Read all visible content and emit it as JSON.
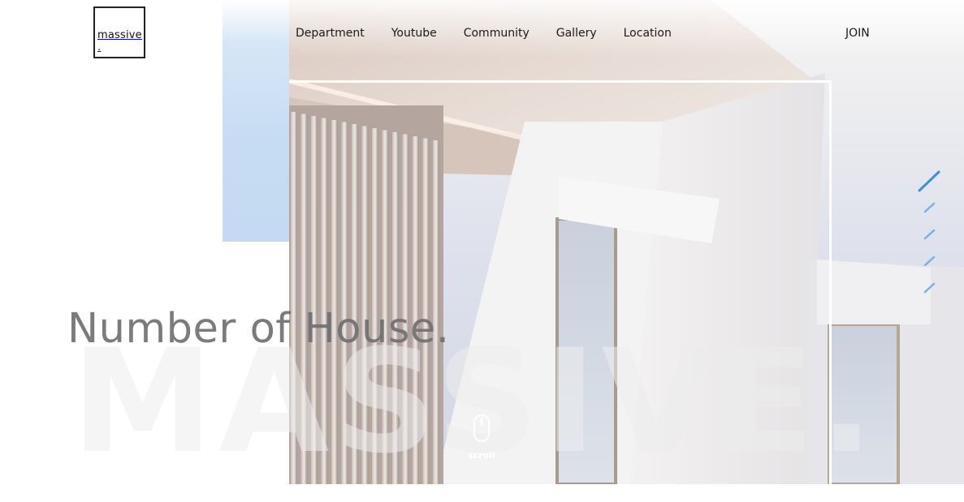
{
  "brand": {
    "logo_text": "massive ."
  },
  "nav": {
    "items": [
      {
        "label": "Department"
      },
      {
        "label": "Youtube"
      },
      {
        "label": "Community"
      },
      {
        "label": "Gallery"
      },
      {
        "label": "Location"
      }
    ],
    "join_label": "JOIN"
  },
  "hero": {
    "headline": "Number of House.",
    "background_word": "MASSIVE.",
    "scroll_label": "scroll"
  },
  "pager": {
    "count": 5,
    "active_index": 0
  },
  "colors": {
    "accent": "#3d8ee0",
    "pager_inactive": "#7ab0e8",
    "side_block": "#c6dcf3",
    "headline": "#707070"
  },
  "icons": {
    "scroll": "mouse-icon"
  }
}
